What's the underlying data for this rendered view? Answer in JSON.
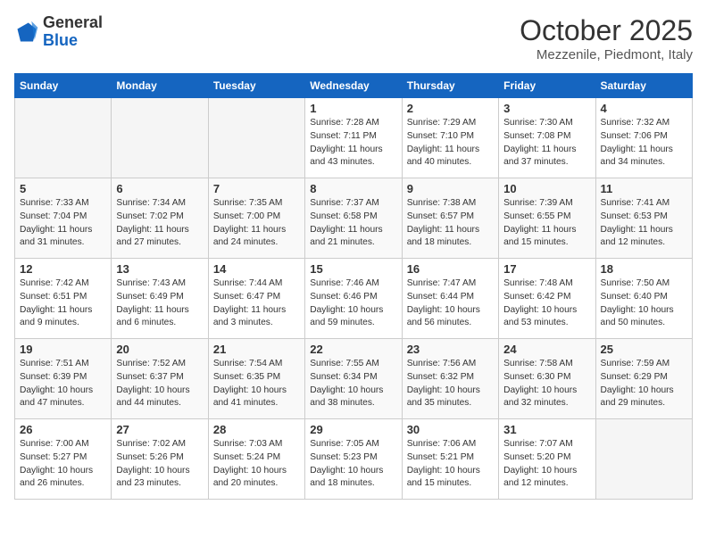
{
  "header": {
    "logo_general": "General",
    "logo_blue": "Blue",
    "month": "October 2025",
    "location": "Mezzenile, Piedmont, Italy"
  },
  "days_of_week": [
    "Sunday",
    "Monday",
    "Tuesday",
    "Wednesday",
    "Thursday",
    "Friday",
    "Saturday"
  ],
  "weeks": [
    [
      {
        "day": "",
        "content": ""
      },
      {
        "day": "",
        "content": ""
      },
      {
        "day": "",
        "content": ""
      },
      {
        "day": "1",
        "content": "Sunrise: 7:28 AM\nSunset: 7:11 PM\nDaylight: 11 hours\nand 43 minutes."
      },
      {
        "day": "2",
        "content": "Sunrise: 7:29 AM\nSunset: 7:10 PM\nDaylight: 11 hours\nand 40 minutes."
      },
      {
        "day": "3",
        "content": "Sunrise: 7:30 AM\nSunset: 7:08 PM\nDaylight: 11 hours\nand 37 minutes."
      },
      {
        "day": "4",
        "content": "Sunrise: 7:32 AM\nSunset: 7:06 PM\nDaylight: 11 hours\nand 34 minutes."
      }
    ],
    [
      {
        "day": "5",
        "content": "Sunrise: 7:33 AM\nSunset: 7:04 PM\nDaylight: 11 hours\nand 31 minutes."
      },
      {
        "day": "6",
        "content": "Sunrise: 7:34 AM\nSunset: 7:02 PM\nDaylight: 11 hours\nand 27 minutes."
      },
      {
        "day": "7",
        "content": "Sunrise: 7:35 AM\nSunset: 7:00 PM\nDaylight: 11 hours\nand 24 minutes."
      },
      {
        "day": "8",
        "content": "Sunrise: 7:37 AM\nSunset: 6:58 PM\nDaylight: 11 hours\nand 21 minutes."
      },
      {
        "day": "9",
        "content": "Sunrise: 7:38 AM\nSunset: 6:57 PM\nDaylight: 11 hours\nand 18 minutes."
      },
      {
        "day": "10",
        "content": "Sunrise: 7:39 AM\nSunset: 6:55 PM\nDaylight: 11 hours\nand 15 minutes."
      },
      {
        "day": "11",
        "content": "Sunrise: 7:41 AM\nSunset: 6:53 PM\nDaylight: 11 hours\nand 12 minutes."
      }
    ],
    [
      {
        "day": "12",
        "content": "Sunrise: 7:42 AM\nSunset: 6:51 PM\nDaylight: 11 hours\nand 9 minutes."
      },
      {
        "day": "13",
        "content": "Sunrise: 7:43 AM\nSunset: 6:49 PM\nDaylight: 11 hours\nand 6 minutes."
      },
      {
        "day": "14",
        "content": "Sunrise: 7:44 AM\nSunset: 6:47 PM\nDaylight: 11 hours\nand 3 minutes."
      },
      {
        "day": "15",
        "content": "Sunrise: 7:46 AM\nSunset: 6:46 PM\nDaylight: 10 hours\nand 59 minutes."
      },
      {
        "day": "16",
        "content": "Sunrise: 7:47 AM\nSunset: 6:44 PM\nDaylight: 10 hours\nand 56 minutes."
      },
      {
        "day": "17",
        "content": "Sunrise: 7:48 AM\nSunset: 6:42 PM\nDaylight: 10 hours\nand 53 minutes."
      },
      {
        "day": "18",
        "content": "Sunrise: 7:50 AM\nSunset: 6:40 PM\nDaylight: 10 hours\nand 50 minutes."
      }
    ],
    [
      {
        "day": "19",
        "content": "Sunrise: 7:51 AM\nSunset: 6:39 PM\nDaylight: 10 hours\nand 47 minutes."
      },
      {
        "day": "20",
        "content": "Sunrise: 7:52 AM\nSunset: 6:37 PM\nDaylight: 10 hours\nand 44 minutes."
      },
      {
        "day": "21",
        "content": "Sunrise: 7:54 AM\nSunset: 6:35 PM\nDaylight: 10 hours\nand 41 minutes."
      },
      {
        "day": "22",
        "content": "Sunrise: 7:55 AM\nSunset: 6:34 PM\nDaylight: 10 hours\nand 38 minutes."
      },
      {
        "day": "23",
        "content": "Sunrise: 7:56 AM\nSunset: 6:32 PM\nDaylight: 10 hours\nand 35 minutes."
      },
      {
        "day": "24",
        "content": "Sunrise: 7:58 AM\nSunset: 6:30 PM\nDaylight: 10 hours\nand 32 minutes."
      },
      {
        "day": "25",
        "content": "Sunrise: 7:59 AM\nSunset: 6:29 PM\nDaylight: 10 hours\nand 29 minutes."
      }
    ],
    [
      {
        "day": "26",
        "content": "Sunrise: 7:00 AM\nSunset: 5:27 PM\nDaylight: 10 hours\nand 26 minutes."
      },
      {
        "day": "27",
        "content": "Sunrise: 7:02 AM\nSunset: 5:26 PM\nDaylight: 10 hours\nand 23 minutes."
      },
      {
        "day": "28",
        "content": "Sunrise: 7:03 AM\nSunset: 5:24 PM\nDaylight: 10 hours\nand 20 minutes."
      },
      {
        "day": "29",
        "content": "Sunrise: 7:05 AM\nSunset: 5:23 PM\nDaylight: 10 hours\nand 18 minutes."
      },
      {
        "day": "30",
        "content": "Sunrise: 7:06 AM\nSunset: 5:21 PM\nDaylight: 10 hours\nand 15 minutes."
      },
      {
        "day": "31",
        "content": "Sunrise: 7:07 AM\nSunset: 5:20 PM\nDaylight: 10 hours\nand 12 minutes."
      },
      {
        "day": "",
        "content": ""
      }
    ]
  ]
}
